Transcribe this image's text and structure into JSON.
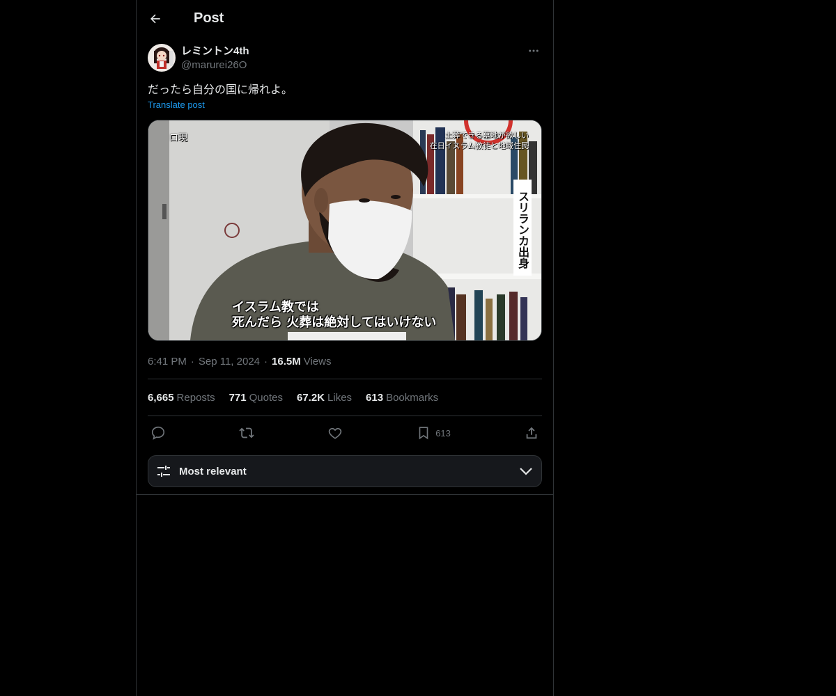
{
  "header": {
    "back_icon": "arrow-left-icon",
    "title": "Post"
  },
  "post": {
    "author": {
      "display_name": "レミントン4th",
      "handle": "@marurei26O"
    },
    "more_icon": "more-horizontal-icon",
    "text": "だったら自分の国に帰れよ。",
    "translate_label": "Translate post",
    "media": {
      "caption_top": "土葬できる墓地が欲しい\n在日イスラム教徒と地域住民",
      "caption_top_left": "ロ現",
      "caption_side": "スリランカ出身",
      "caption_bottom": "イスラム教では\n死んだら 火葬は絶対してはいけない"
    },
    "time": "6:41 PM",
    "date": "Sep 11, 2024",
    "views_count": "16.5M",
    "views_label": "Views"
  },
  "stats": {
    "reposts_count": "6,665",
    "reposts_label": "Reposts",
    "quotes_count": "771",
    "quotes_label": "Quotes",
    "likes_count": "67.2K",
    "likes_label": "Likes",
    "bookmarks_count": "613",
    "bookmarks_label": "Bookmarks"
  },
  "actions": {
    "reply_icon": "reply-icon",
    "repost_icon": "repost-icon",
    "like_icon": "heart-icon",
    "bookmark_icon": "bookmark-icon",
    "bookmark_count": "613",
    "share_icon": "share-icon"
  },
  "sort": {
    "label": "Most relevant",
    "icon": "sliders-icon",
    "chevron_icon": "chevron-down-icon"
  },
  "colors": {
    "background": "#000000",
    "border": "#2f3336",
    "text_primary": "#e7e9ea",
    "text_secondary": "#71767b",
    "link": "#1d9bf0"
  }
}
